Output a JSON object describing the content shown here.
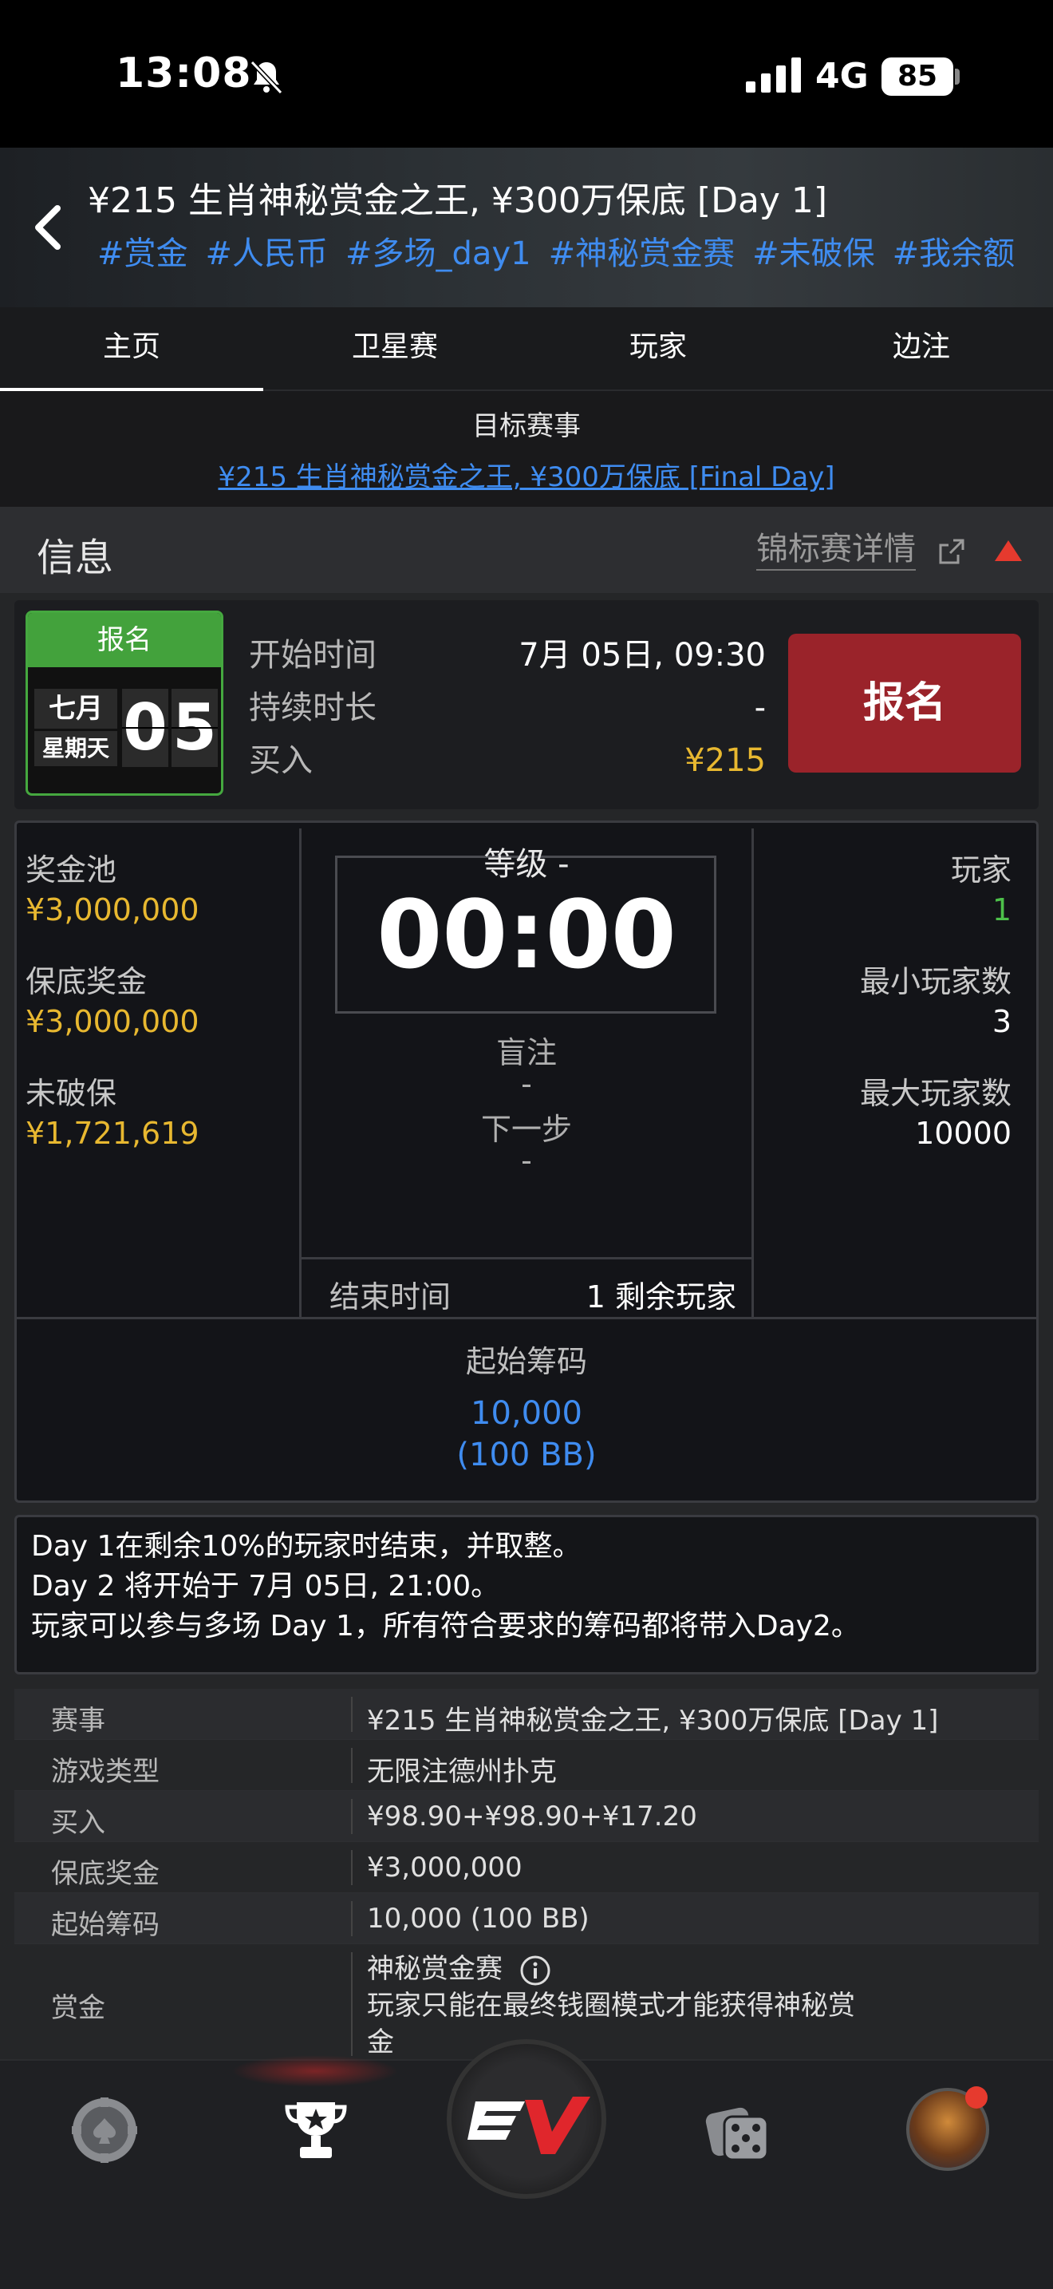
{
  "status_bar": {
    "time": "13:08",
    "network": "4G",
    "battery": "85"
  },
  "header": {
    "title": "¥215 生肖神秘赏金之王, ¥300万保底 [Day 1]",
    "tags": [
      "#赏金",
      "#人民币",
      "#多场_day1",
      "#神秘赏金赛",
      "#未破保",
      "#我余额"
    ]
  },
  "tabs": [
    "主页",
    "卫星赛",
    "玩家",
    "边注"
  ],
  "target_event": {
    "label": "目标赛事",
    "link": "¥215 生肖神秘赏金之王, ¥300万保底 [Final Day]"
  },
  "info": {
    "title": "信息",
    "details_link": "锦标赛详情"
  },
  "registration": {
    "calendar_header": "报名",
    "month": "七月",
    "weekday": "星期天",
    "day_digits": [
      "0",
      "5"
    ],
    "start_label": "开始时间",
    "start_value": "7月 05日, 09:30",
    "duration_label": "持续时长",
    "duration_value": "-",
    "buyin_label": "买入",
    "buyin_value": "¥215",
    "register_button": "报名"
  },
  "stats": {
    "prize_pool_label": "奖金池",
    "prize_pool": "¥3,000,000",
    "guarantee_label": "保底奖金",
    "guarantee": "¥3,000,000",
    "overlay_label": "未破保",
    "overlay": "¥1,721,619",
    "level": "等级 -",
    "clock": "00:00",
    "blinds_label": "盲注",
    "blinds_value": "-",
    "next_label": "下一步",
    "next_value": "-",
    "end_label": "结束时间",
    "remaining": "1 剩余玩家",
    "players_label": "玩家",
    "players": "1",
    "min_players_label": "最小玩家数",
    "min_players": "3",
    "max_players_label": "最大玩家数",
    "max_players": "10000",
    "starting_chips_label": "起始筹码",
    "starting_chips": "10,000",
    "starting_bb": "(100 BB)"
  },
  "notes": [
    "Day 1在剩余10%的玩家时结束，并取整。",
    "Day 2 将开始于 7月 05日, 21:00。",
    "玩家可以参与多场 Day 1，所有符合要求的筹码都将带入Day2。"
  ],
  "details": [
    {
      "k": "赛事",
      "v": "¥215 生肖神秘赏金之王, ¥300万保底 [Day 1]"
    },
    {
      "k": "游戏类型",
      "v": "无限注德州扑克"
    },
    {
      "k": "买入",
      "v": "¥98.90+¥98.90+¥17.20"
    },
    {
      "k": "保底奖金",
      "v": "¥3,000,000"
    },
    {
      "k": "起始筹码",
      "v": "10,000 (100 BB)"
    },
    {
      "k": "赏金",
      "v": "神秘赏金赛",
      "v2": "玩家只能在最终钱圈模式才能获得神秘赏",
      "v3": "金"
    }
  ],
  "colors": {
    "accent_blue": "#3f8cf0",
    "gold": "#e8b830",
    "register_red": "#9a232a",
    "calendar_green": "#43a23c",
    "notify_red": "#e63a2e"
  }
}
